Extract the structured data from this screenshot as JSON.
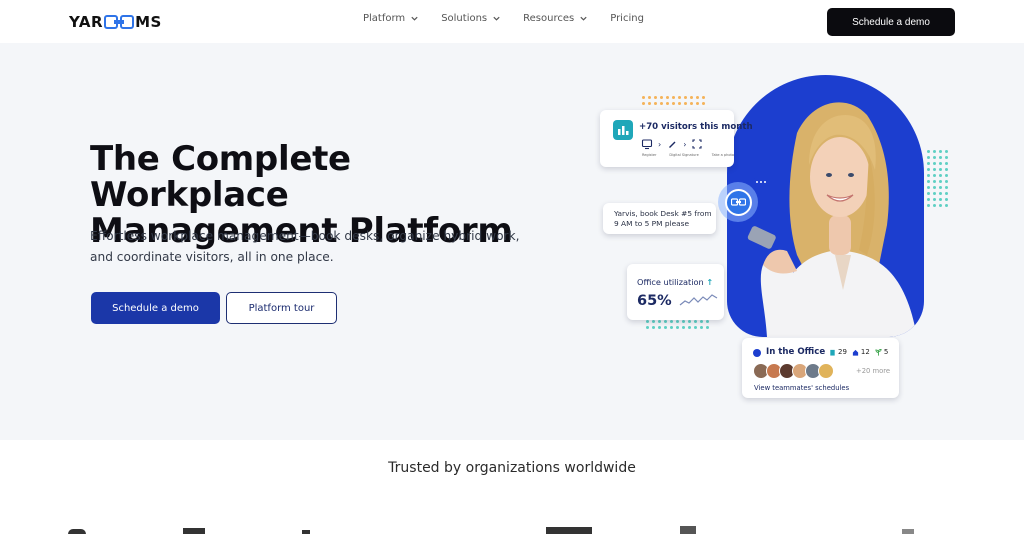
{
  "brand": {
    "name_left": "YAR",
    "name_right": "MS"
  },
  "nav": {
    "items": [
      {
        "label": "Platform",
        "dropdown": true
      },
      {
        "label": "Solutions",
        "dropdown": true
      },
      {
        "label": "Resources",
        "dropdown": true
      },
      {
        "label": "Pricing",
        "dropdown": false
      }
    ],
    "cta_label": "Schedule a demo"
  },
  "hero": {
    "title_line1": "The Complete Workplace",
    "title_line2": "Management Platform",
    "subtitle": "Effortless workplace management—book desks, organize hybrid work, and coordinate visitors, all in one place.",
    "primary_label": "Schedule a demo",
    "secondary_label": "Platform tour"
  },
  "illustration": {
    "visitors": {
      "title": "+70 visitors this month",
      "steps": [
        "Register",
        "Digital Signature",
        "Take a photo"
      ]
    },
    "booking": {
      "text": "Yarvis, book Desk #5 from 9 AM to 5 PM please"
    },
    "utilization": {
      "title": "Office utilization",
      "arrow": "↑",
      "value": "65%",
      "progress": 0.65
    },
    "office": {
      "title": "In the Office",
      "stats": [
        "29",
        "12",
        "5"
      ],
      "more": "+20 more",
      "link": "View teammates' schedules"
    }
  },
  "colors": {
    "primary": "#1b37a8",
    "accent": "#1fa7b9",
    "dark": "#0b0b0f",
    "hero_bg": "#f4f6f9"
  },
  "trusted": {
    "title": "Trusted by organizations worldwide"
  }
}
